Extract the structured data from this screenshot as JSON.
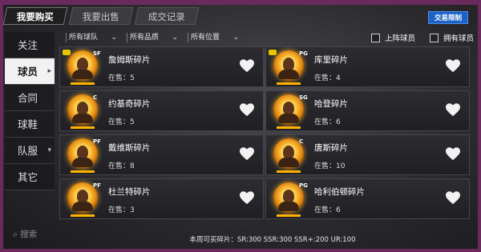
{
  "tabs": [
    {
      "label": "我要购买",
      "active": true
    },
    {
      "label": "我要出售",
      "active": false
    },
    {
      "label": "成交记录",
      "active": false
    }
  ],
  "trade_limit_button": "交易限制",
  "sidebar": {
    "items": [
      {
        "label": "关注",
        "active": false,
        "has_arrow": false
      },
      {
        "label": "球员",
        "active": true,
        "has_arrow": true
      },
      {
        "label": "合同",
        "active": false,
        "has_arrow": false
      },
      {
        "label": "球鞋",
        "active": false,
        "has_arrow": false
      },
      {
        "label": "队服",
        "active": false,
        "has_arrow": true
      },
      {
        "label": "其它",
        "active": false,
        "has_arrow": false
      }
    ],
    "search_label": "搜索"
  },
  "filters": [
    {
      "label": "所有球队"
    },
    {
      "label": "所有品质"
    },
    {
      "label": "所有位置"
    }
  ],
  "checkboxes": [
    {
      "label": "上阵球员",
      "checked": false
    },
    {
      "label": "拥有球员",
      "checked": false
    }
  ],
  "cards": [
    {
      "name": "詹姆斯碎片",
      "position": "SF",
      "on_sale_label": "在售：5",
      "locked": true
    },
    {
      "name": "库里碎片",
      "position": "PG",
      "on_sale_label": "在售：4",
      "locked": true
    },
    {
      "name": "约基奇碎片",
      "position": "C",
      "on_sale_label": "在售：5",
      "locked": false
    },
    {
      "name": "哈登碎片",
      "position": "SG",
      "on_sale_label": "在售：6",
      "locked": false
    },
    {
      "name": "戴维斯碎片",
      "position": "PF",
      "on_sale_label": "在售：8",
      "locked": false
    },
    {
      "name": "唐斯碎片",
      "position": "C",
      "on_sale_label": "在售：10",
      "locked": false
    },
    {
      "name": "杜兰特碎片",
      "position": "PF",
      "on_sale_label": "在售：3",
      "locked": false
    },
    {
      "name": "哈利伯顿碎片",
      "position": "PG",
      "on_sale_label": "在售：6",
      "locked": false
    }
  ],
  "footer_text": "本周可买碎片：SR:300 SSR:300 SSR+:200 UR:100",
  "colors": {
    "frame": "#6b2a5e",
    "accent_blue": "#1b63c6",
    "gold": "#ffb300"
  }
}
